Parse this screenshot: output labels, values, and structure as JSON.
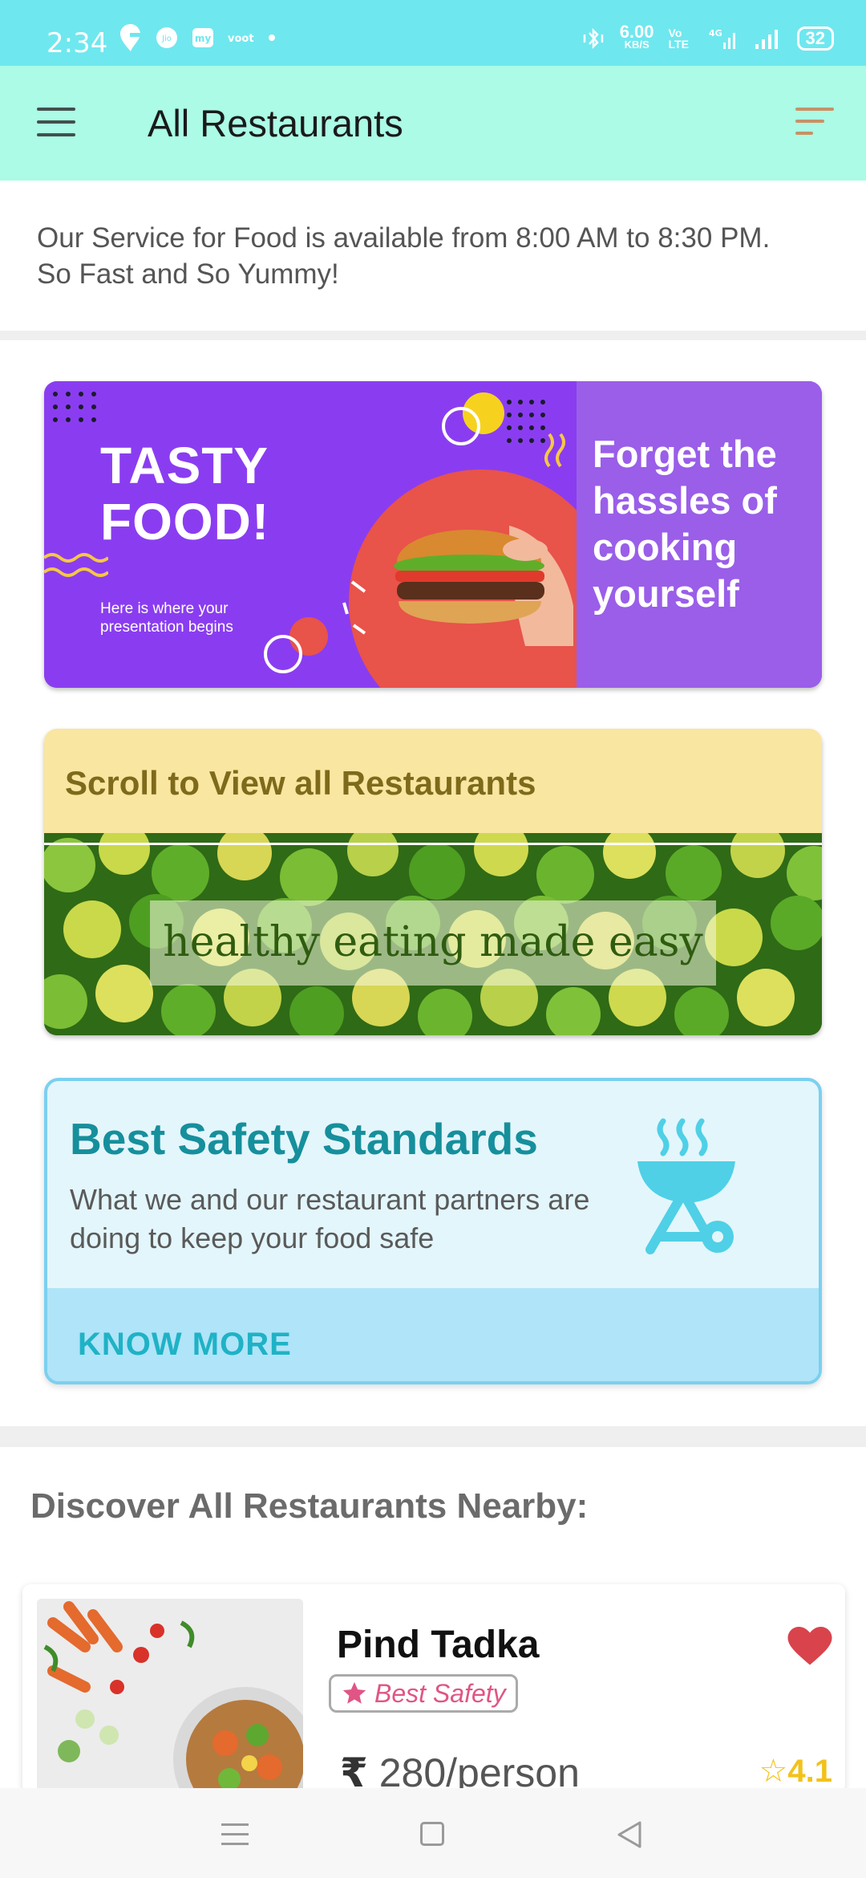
{
  "status_bar": {
    "time": "2:34",
    "left_icons": [
      "swiggy-icon",
      "jio-icon",
      "my-icon",
      "voot-icon",
      "dot"
    ],
    "network_speed": "6.00",
    "network_unit": "KB/S",
    "volte": "Vo LTE",
    "network_type": "4G",
    "battery": "32"
  },
  "app_bar": {
    "title": "All Restaurants"
  },
  "service_notice": {
    "line1": "Our Service for Food is available from 8:00 AM to 8:30 PM.",
    "line2": "So Fast and So Yummy!"
  },
  "banner_food": {
    "headline": "TASTY FOOD!",
    "subtext": "Here is where your presentation begins",
    "tagline": "Forget the hassles of cooking yourself"
  },
  "banner_scroll": {
    "title": "Scroll to View all Restaurants",
    "overlay_text": "healthy eating made easy"
  },
  "safety_card": {
    "title": "Best Safety Standards",
    "description": "What we and our restaurant partners are doing to keep your food safe",
    "cta": "KNOW MORE"
  },
  "section_heading": "Discover All Restaurants Nearby:",
  "restaurants": [
    {
      "name": "Pind Tadka",
      "badge": "Best Safety",
      "currency": "₹",
      "price": "280/person",
      "rating": "4.1",
      "favorited": true
    }
  ],
  "colors": {
    "status_bar": "#6fe7ef",
    "app_bar": "#abfbe6",
    "banner_purple": "#8a3df0",
    "safety_accent": "#168f9c",
    "heart": "#d9434c",
    "rating": "#f3c21a"
  }
}
